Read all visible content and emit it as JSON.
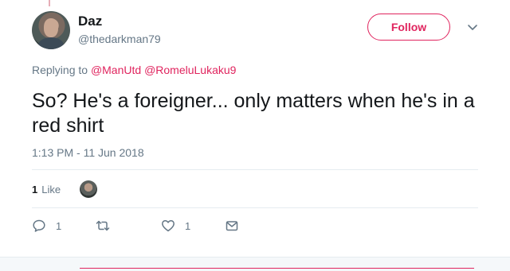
{
  "colors": {
    "accent": "#e0245e",
    "secondary_text": "#657786",
    "primary_text": "#14171a",
    "divider": "#e6ecf0"
  },
  "author": {
    "name": "Daz",
    "handle": "@thedarkman79"
  },
  "follow_label": "Follow",
  "reply_context": {
    "prefix": "Replying to",
    "mentions": [
      "@ManUtd",
      "@RomeluLukaku9"
    ]
  },
  "tweet": {
    "text": "So? He's a foreigner... only matters when he's in a red shirt",
    "timestamp": "1:13 PM - 11 Jun 2018"
  },
  "stats": {
    "likes_count": "1",
    "likes_label": "Like"
  },
  "actions": {
    "reply": {
      "icon": "reply-icon",
      "count": "1"
    },
    "retweet": {
      "icon": "retweet-icon",
      "count": ""
    },
    "like": {
      "icon": "heart-icon",
      "count": "1"
    },
    "message": {
      "icon": "envelope-icon",
      "count": ""
    }
  }
}
